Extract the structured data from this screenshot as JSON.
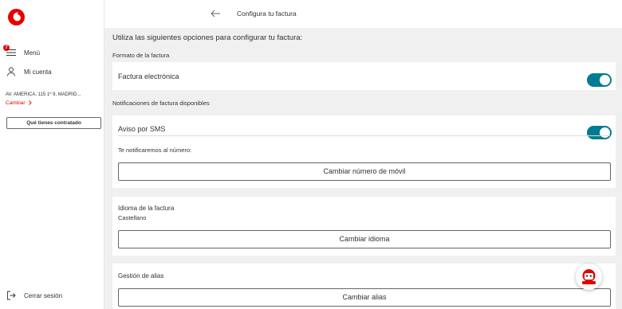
{
  "sidebar": {
    "menu_label": "Menú",
    "menu_badge": "7",
    "account_label": "Mi cuenta",
    "address": "AV. AMERICA, 115 1º 9, MADRID...",
    "change_label": "Cambiar",
    "contract_button": "Qué tienes contratado",
    "logout_label": "Cerrar sesión"
  },
  "header": {
    "title": "Configura tu factura"
  },
  "main": {
    "intro": "Utiliza las siguientes opciones para configurar tu factura:",
    "format_section": "Formato de la factura",
    "electronic_invoice": "Factura electrónica",
    "notifications_section": "Notificaciones de factura disponibles",
    "sms_label": "Aviso por SMS",
    "notify_text": "Te notificaremos al número:",
    "change_mobile_button": "Cambiar número de móvil",
    "language_title": "Idioma de la factura",
    "language_value": "Castellano",
    "change_language_button": "Cambiar idioma",
    "alias_title": "Gestión de alias",
    "change_alias_button": "Cambiar alias"
  },
  "toggles": {
    "electronic_invoice_on": true,
    "sms_on": true
  },
  "colors": {
    "brand_red": "#e60000",
    "toggle_teal": "#007c92",
    "background_gray": "#f0f0f0"
  },
  "icons": [
    "vodafone-logo",
    "hamburger-icon",
    "user-icon",
    "chevron-right-icon",
    "logout-icon",
    "back-arrow-icon",
    "chat-assistant-icon"
  ]
}
